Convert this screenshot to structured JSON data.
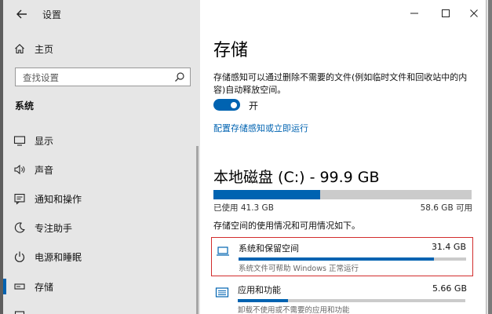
{
  "window": {
    "title": "设置"
  },
  "sidebar": {
    "home_label": "主页",
    "search_placeholder": "查找设置",
    "section_title": "系统",
    "items": [
      {
        "label": "显示",
        "icon": "monitor-icon",
        "active": false
      },
      {
        "label": "声音",
        "icon": "speaker-icon",
        "active": false
      },
      {
        "label": "通知和操作",
        "icon": "notification-icon",
        "active": false
      },
      {
        "label": "专注助手",
        "icon": "moon-icon",
        "active": false
      },
      {
        "label": "电源和睡眠",
        "icon": "power-icon",
        "active": false
      },
      {
        "label": "存储",
        "icon": "storage-icon",
        "active": true
      }
    ]
  },
  "main": {
    "title": "存储",
    "description": "存储感知可以通过删除不需要的文件(例如临时文件和回收站中的内容)自动释放空间。",
    "toggle": {
      "state": "on",
      "label": "开"
    },
    "configure_link": "配置存储感知或立即运行",
    "disk": {
      "title": "本地磁盘 (C:) - 99.9 GB",
      "used_label": "已使用 41.3 GB",
      "available_label": "58.6 GB 可用",
      "used_fraction": 0.413
    },
    "usage_note": "存储空间的使用情况和可用情况如下。",
    "categories": [
      {
        "name": "系统和保留空间",
        "size": "31.4 GB",
        "sub": "系统文件可帮助 Windows 正常运行",
        "fraction": 0.86,
        "icon": "laptop-icon",
        "selected": true
      },
      {
        "name": "应用和功能",
        "size": "5.66 GB",
        "sub": "卸载不使用或不需要的应用和功能",
        "fraction": 0.22,
        "icon": "apps-icon",
        "selected": false
      }
    ]
  },
  "colors": {
    "accent": "#0063b1",
    "highlight_border": "#d22d2d",
    "sidebar_bg": "#e6e6e6"
  }
}
